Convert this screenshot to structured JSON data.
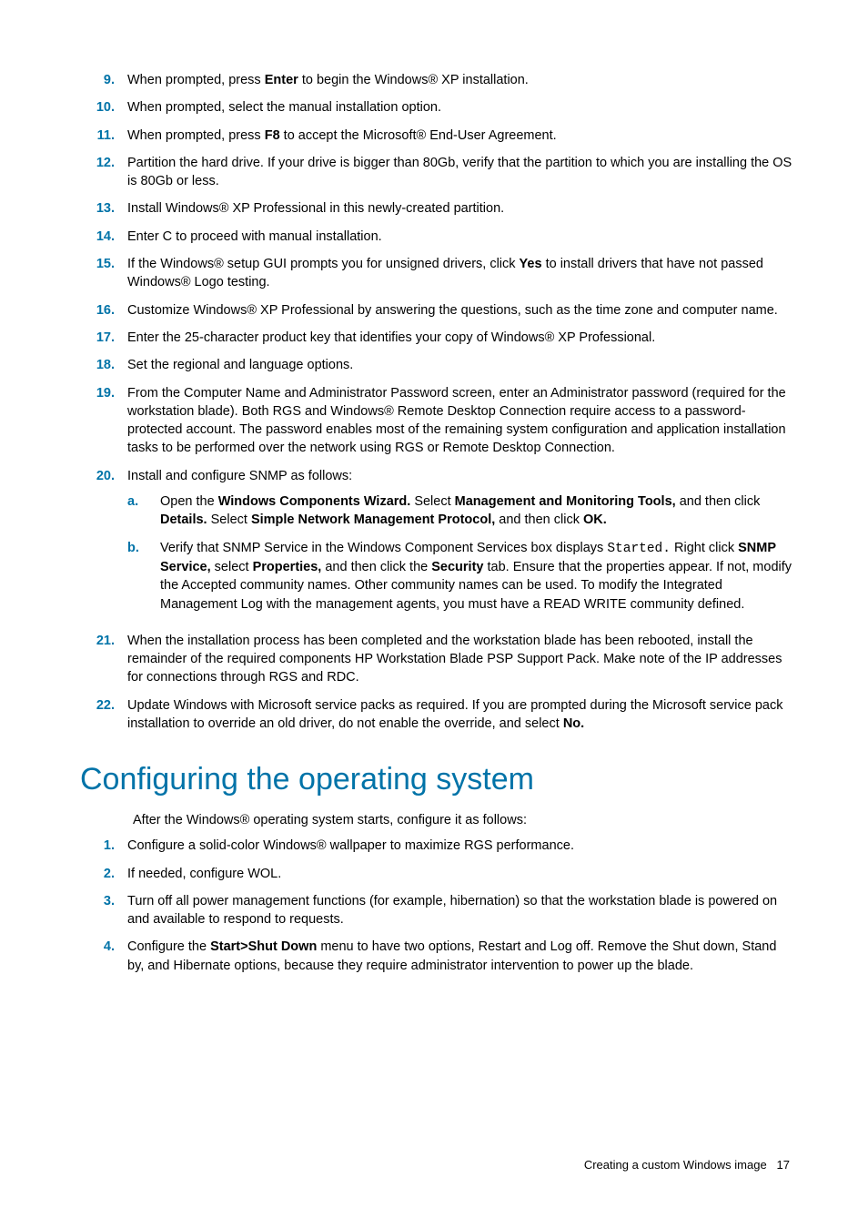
{
  "steps": [
    {
      "n": "9.",
      "runs": [
        {
          "t": "When prompted, press "
        },
        {
          "t": "Enter",
          "b": true
        },
        {
          "t": " to begin the Windows® XP installation."
        }
      ]
    },
    {
      "n": "10.",
      "runs": [
        {
          "t": "When prompted, select the manual installation option."
        }
      ]
    },
    {
      "n": "11.",
      "runs": [
        {
          "t": "When prompted, press "
        },
        {
          "t": "F8",
          "b": true
        },
        {
          "t": " to accept the Microsoft® End-User Agreement."
        }
      ]
    },
    {
      "n": "12.",
      "runs": [
        {
          "t": "Partition the hard drive. If your drive is bigger than 80Gb, verify that the partition to which you are installing the OS is 80Gb or less."
        }
      ]
    },
    {
      "n": "13.",
      "runs": [
        {
          "t": "Install Windows® XP Professional in this newly-created partition."
        }
      ]
    },
    {
      "n": "14.",
      "runs": [
        {
          "t": "Enter C to proceed with manual installation."
        }
      ]
    },
    {
      "n": "15.",
      "runs": [
        {
          "t": "If the Windows® setup GUI prompts you for unsigned drivers, click "
        },
        {
          "t": "Yes",
          "b": true
        },
        {
          "t": " to install drivers that have not passed Windows® Logo testing."
        }
      ]
    },
    {
      "n": "16.",
      "runs": [
        {
          "t": "Customize Windows® XP Professional by answering the questions, such as the time zone and computer name."
        }
      ]
    },
    {
      "n": "17.",
      "runs": [
        {
          "t": "Enter the 25-character product key that identifies your copy of Windows® XP Professional."
        }
      ]
    },
    {
      "n": "18.",
      "runs": [
        {
          "t": "Set the regional and language options."
        }
      ]
    },
    {
      "n": "19.",
      "runs": [
        {
          "t": "From the Computer Name and Administrator Password screen, enter an Administrator password (required for the workstation blade). Both RGS and Windows® Remote Desktop Connection require access to a password-protected account. The password enables most of the remaining system configuration and application installation tasks to be performed over the network using RGS or Remote Desktop Connection."
        }
      ]
    },
    {
      "n": "20.",
      "runs": [
        {
          "t": "Install and configure SNMP as follows:"
        }
      ],
      "sub": [
        {
          "n": "a.",
          "runs": [
            {
              "t": "Open the "
            },
            {
              "t": "Windows Components Wizard.",
              "b": true
            },
            {
              "t": " Select "
            },
            {
              "t": "Management and Monitoring Tools,",
              "b": true
            },
            {
              "t": " and then click "
            },
            {
              "t": "Details.",
              "b": true
            },
            {
              "t": " Select "
            },
            {
              "t": "Simple Network Management Protocol,",
              "b": true
            },
            {
              "t": " and then click "
            },
            {
              "t": "OK.",
              "b": true
            }
          ]
        },
        {
          "n": "b.",
          "runs": [
            {
              "t": "Verify that SNMP Service in the Windows Component Services box displays "
            },
            {
              "t": "Started.",
              "m": true
            },
            {
              "t": " Right click "
            },
            {
              "t": "SNMP Service,",
              "b": true
            },
            {
              "t": " select "
            },
            {
              "t": "Properties,",
              "b": true
            },
            {
              "t": " and then click the "
            },
            {
              "t": "Security",
              "b": true
            },
            {
              "t": " tab. Ensure that the properties appear. If not, modify the Accepted community names. Other community names can be used. To modify the Integrated Management Log with the management agents, you must have a READ WRITE community defined."
            }
          ]
        }
      ]
    },
    {
      "n": "21.",
      "runs": [
        {
          "t": "When the installation process has been completed and the workstation blade has been rebooted, install the remainder of the required components HP Workstation Blade PSP Support Pack. Make note of the IP addresses for connections through RGS and RDC."
        }
      ]
    },
    {
      "n": "22.",
      "runs": [
        {
          "t": "Update Windows with Microsoft service packs as required. If you are prompted during the Microsoft service pack installation to override an old driver, do not enable the override, and select "
        },
        {
          "t": "No.",
          "b": true
        }
      ]
    }
  ],
  "heading": "Configuring the operating system",
  "intro": "After the Windows® operating system starts, configure it as follows:",
  "configSteps": [
    {
      "n": "1.",
      "runs": [
        {
          "t": "Configure a solid-color Windows® wallpaper to maximize RGS performance."
        }
      ]
    },
    {
      "n": "2.",
      "runs": [
        {
          "t": "If needed, configure WOL."
        }
      ]
    },
    {
      "n": "3.",
      "runs": [
        {
          "t": "Turn off all power management functions (for example, hibernation) so that the workstation blade is powered on and available to respond to requests."
        }
      ]
    },
    {
      "n": "4.",
      "runs": [
        {
          "t": "Configure the "
        },
        {
          "t": "Start>Shut Down",
          "b": true
        },
        {
          "t": " menu to have two options, Restart and Log off. Remove the Shut down, Stand by, and Hibernate options, because they require administrator intervention to power up the blade."
        }
      ]
    }
  ],
  "footerText": "Creating a custom Windows image",
  "pageNum": "17"
}
